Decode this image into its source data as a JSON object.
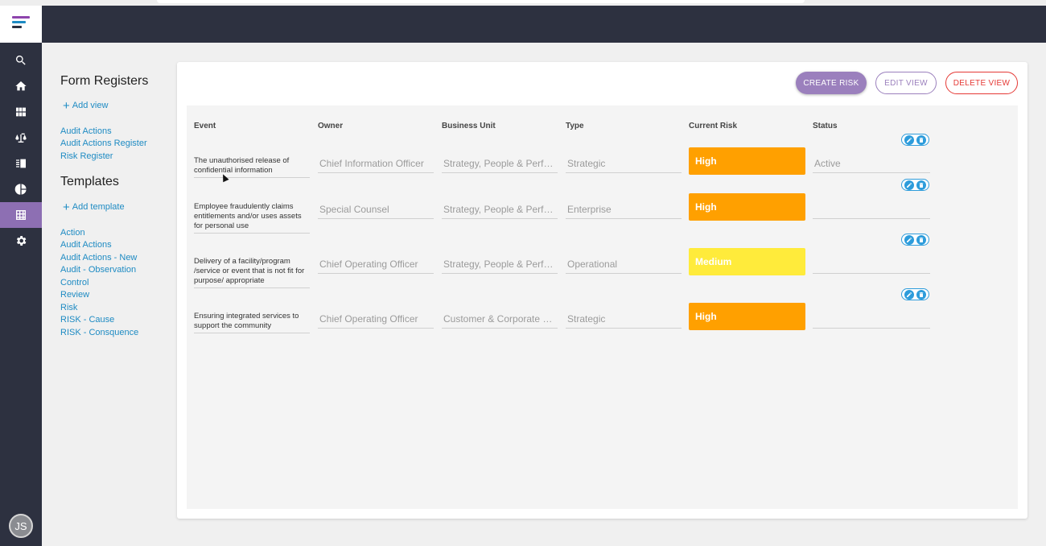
{
  "sidebar": {
    "nav": [
      {
        "name": "search-icon"
      },
      {
        "name": "home-icon"
      },
      {
        "name": "apps-icon"
      },
      {
        "name": "balance-icon"
      },
      {
        "name": "document-icon"
      },
      {
        "name": "pie-chart-icon"
      },
      {
        "name": "table-icon",
        "active": true
      },
      {
        "name": "gear-icon"
      }
    ],
    "avatar_initials": "JS"
  },
  "left_panel": {
    "form_registers_title": "Form Registers",
    "add_view_label": "Add view",
    "registers": [
      "Audit Actions",
      "Audit Actions Register",
      "Risk Register"
    ],
    "templates_title": "Templates",
    "add_template_label": "Add template",
    "templates": [
      "Action",
      "Audit Actions",
      "Audit Actions - New",
      "Audit - Observation",
      "Control",
      "Review",
      "Risk",
      "RISK - Cause",
      "RISK - Consquence"
    ]
  },
  "toolbar": {
    "create_label": "CREATE RISK",
    "edit_label": "EDIT VIEW",
    "delete_label": "DELETE VIEW"
  },
  "table": {
    "columns": [
      "Event",
      "Owner",
      "Business Unit",
      "Type",
      "Current Risk",
      "Status"
    ],
    "rows": [
      {
        "event": "The unauthorised release of confidential information",
        "owner": "Chief Information Officer",
        "business_unit": "Strategy, People & Performance",
        "type": "Strategic",
        "current_risk": "High",
        "status": "Active"
      },
      {
        "event": "Employee fraudulently claims entitlements and/or uses assets for personal use",
        "owner": "Special Counsel",
        "business_unit": "Strategy, People & Performance",
        "type": "Enterprise",
        "current_risk": "High",
        "status": ""
      },
      {
        "event": "Delivery of a facility/program /service or event that is not fit for purpose/ appropriate",
        "owner": "Chief Operating Officer",
        "business_unit": "Strategy, People & Performance",
        "type": "Operational",
        "current_risk": "Medium",
        "status": ""
      },
      {
        "event": "Ensuring integrated services to support the community",
        "owner": "Chief Operating Officer",
        "business_unit": "Customer & Corporate Services",
        "type": "Strategic",
        "current_risk": "High",
        "status": ""
      }
    ]
  },
  "colors": {
    "sidebar_bg": "#2d3140",
    "accent_purple": "#9b80bd",
    "danger_red": "#e53935",
    "link_blue": "#1e8bc3",
    "risk_high": "#ffa000",
    "risk_medium": "#ffeb3b"
  }
}
